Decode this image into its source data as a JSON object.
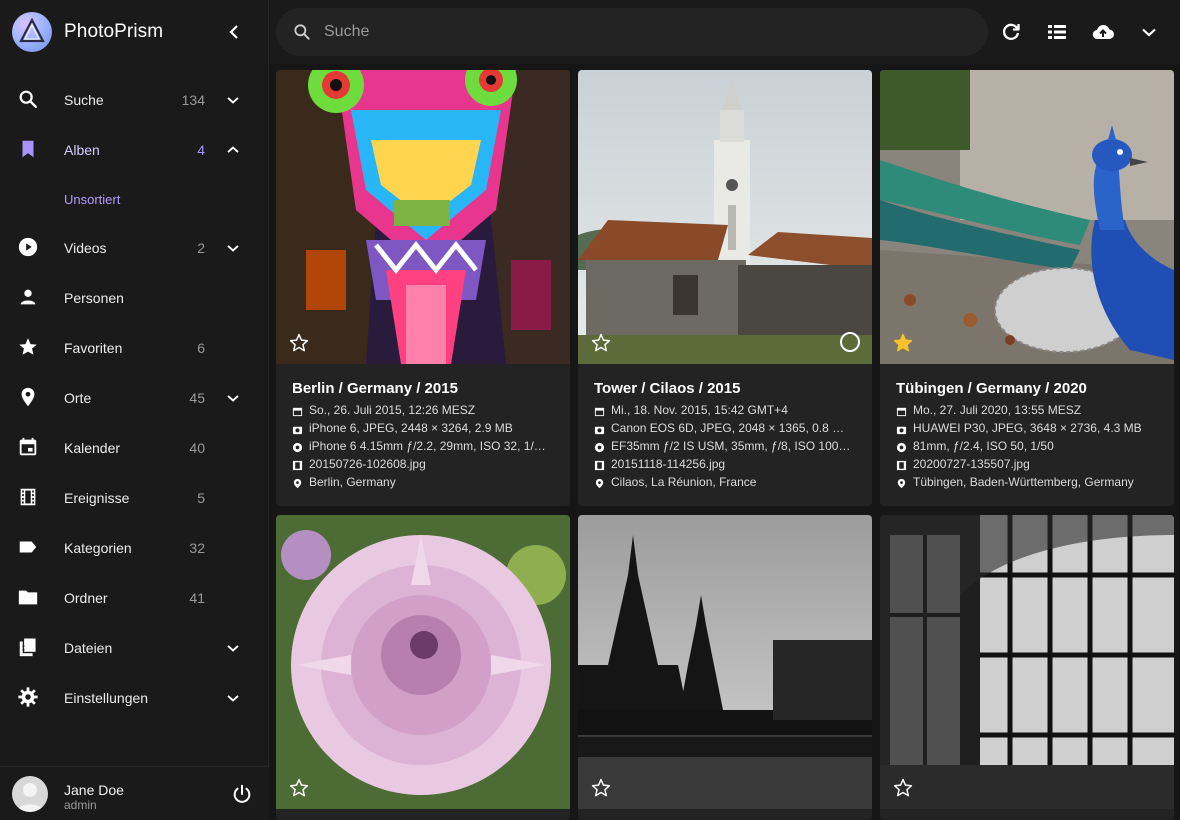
{
  "brand": {
    "title": "PhotoPrism"
  },
  "nav": [
    {
      "id": "search",
      "label": "Suche",
      "count": "134",
      "icon": "search-icon",
      "chevron": "down"
    },
    {
      "id": "albums",
      "label": "Alben",
      "count": "4",
      "icon": "bookmark-icon",
      "chevron": "up",
      "active": true
    },
    {
      "id": "videos",
      "label": "Videos",
      "count": "2",
      "icon": "play-circle-icon",
      "chevron": "down"
    },
    {
      "id": "people",
      "label": "Personen",
      "count": "",
      "icon": "person-icon"
    },
    {
      "id": "favorites",
      "label": "Favoriten",
      "count": "6",
      "icon": "star-icon"
    },
    {
      "id": "places",
      "label": "Orte",
      "count": "45",
      "icon": "map-pin-icon",
      "chevron": "down"
    },
    {
      "id": "calendar",
      "label": "Kalender",
      "count": "40",
      "icon": "calendar-icon"
    },
    {
      "id": "moments",
      "label": "Ereignisse",
      "count": "5",
      "icon": "film-icon"
    },
    {
      "id": "labels",
      "label": "Kategorien",
      "count": "32",
      "icon": "label-icon"
    },
    {
      "id": "folders",
      "label": "Ordner",
      "count": "41",
      "icon": "folder-icon"
    },
    {
      "id": "files",
      "label": "Dateien",
      "count": "",
      "icon": "files-icon",
      "chevron": "down"
    },
    {
      "id": "settings",
      "label": "Einstellungen",
      "count": "",
      "icon": "gear-icon",
      "chevron": "down"
    }
  ],
  "nav_sub": {
    "unsorted": "Unsortiert"
  },
  "user": {
    "name": "Jane Doe",
    "role": "admin"
  },
  "search": {
    "placeholder": "Suche"
  },
  "toolbar": {
    "icons": [
      "refresh-icon",
      "list-view-icon",
      "cloud-upload-icon",
      "chevron-down-icon"
    ]
  },
  "photos": [
    {
      "title": "Berlin / Germany / 2015",
      "date": "So., 26. Juli 2015, 12:26 MESZ",
      "camera": "iPhone 6, JPEG, 2448 × 3264, 2.9 MB",
      "lens": "iPhone 6 4.15mm ƒ/2.2, 29mm, ISO 32, 1/…",
      "file": "20150726-102608.jpg",
      "location": "Berlin, Germany",
      "favorite": false,
      "thumb": "graffiti"
    },
    {
      "title": "Tower / Cilaos / 2015",
      "date": "Mi., 18. Nov. 2015, 15:42 GMT+4",
      "camera": "Canon EOS 6D, JPEG, 2048 × 1365, 0.8 …",
      "lens": "EF35mm ƒ/2 IS USM, 35mm, ƒ/8, ISO 100…",
      "file": "20151118-114256.jpg",
      "location": "Cilaos, La Réunion, France",
      "favorite": false,
      "thumb": "tower"
    },
    {
      "title": "Tübingen / Germany / 2020",
      "date": "Mo., 27. Juli 2020, 13:55 MESZ",
      "camera": "HUAWEI P30, JPEG, 3648 × 2736, 4.3 MB",
      "lens": "81mm, ƒ/2.4, ISO 50, 1/50",
      "file": "20200727-135507.jpg",
      "location": "Tübingen, Baden-Württemberg, Germany",
      "favorite": true,
      "thumb": "peacock"
    },
    {
      "favorite": false,
      "thumb": "dahlia"
    },
    {
      "favorite": false,
      "thumb": "bridge"
    },
    {
      "favorite": false,
      "thumb": "windows"
    }
  ],
  "colors": {
    "accent": "#a994ff",
    "favorite": "#f7c12b",
    "card": "#232323",
    "sidebar": "#1a1a1a"
  }
}
